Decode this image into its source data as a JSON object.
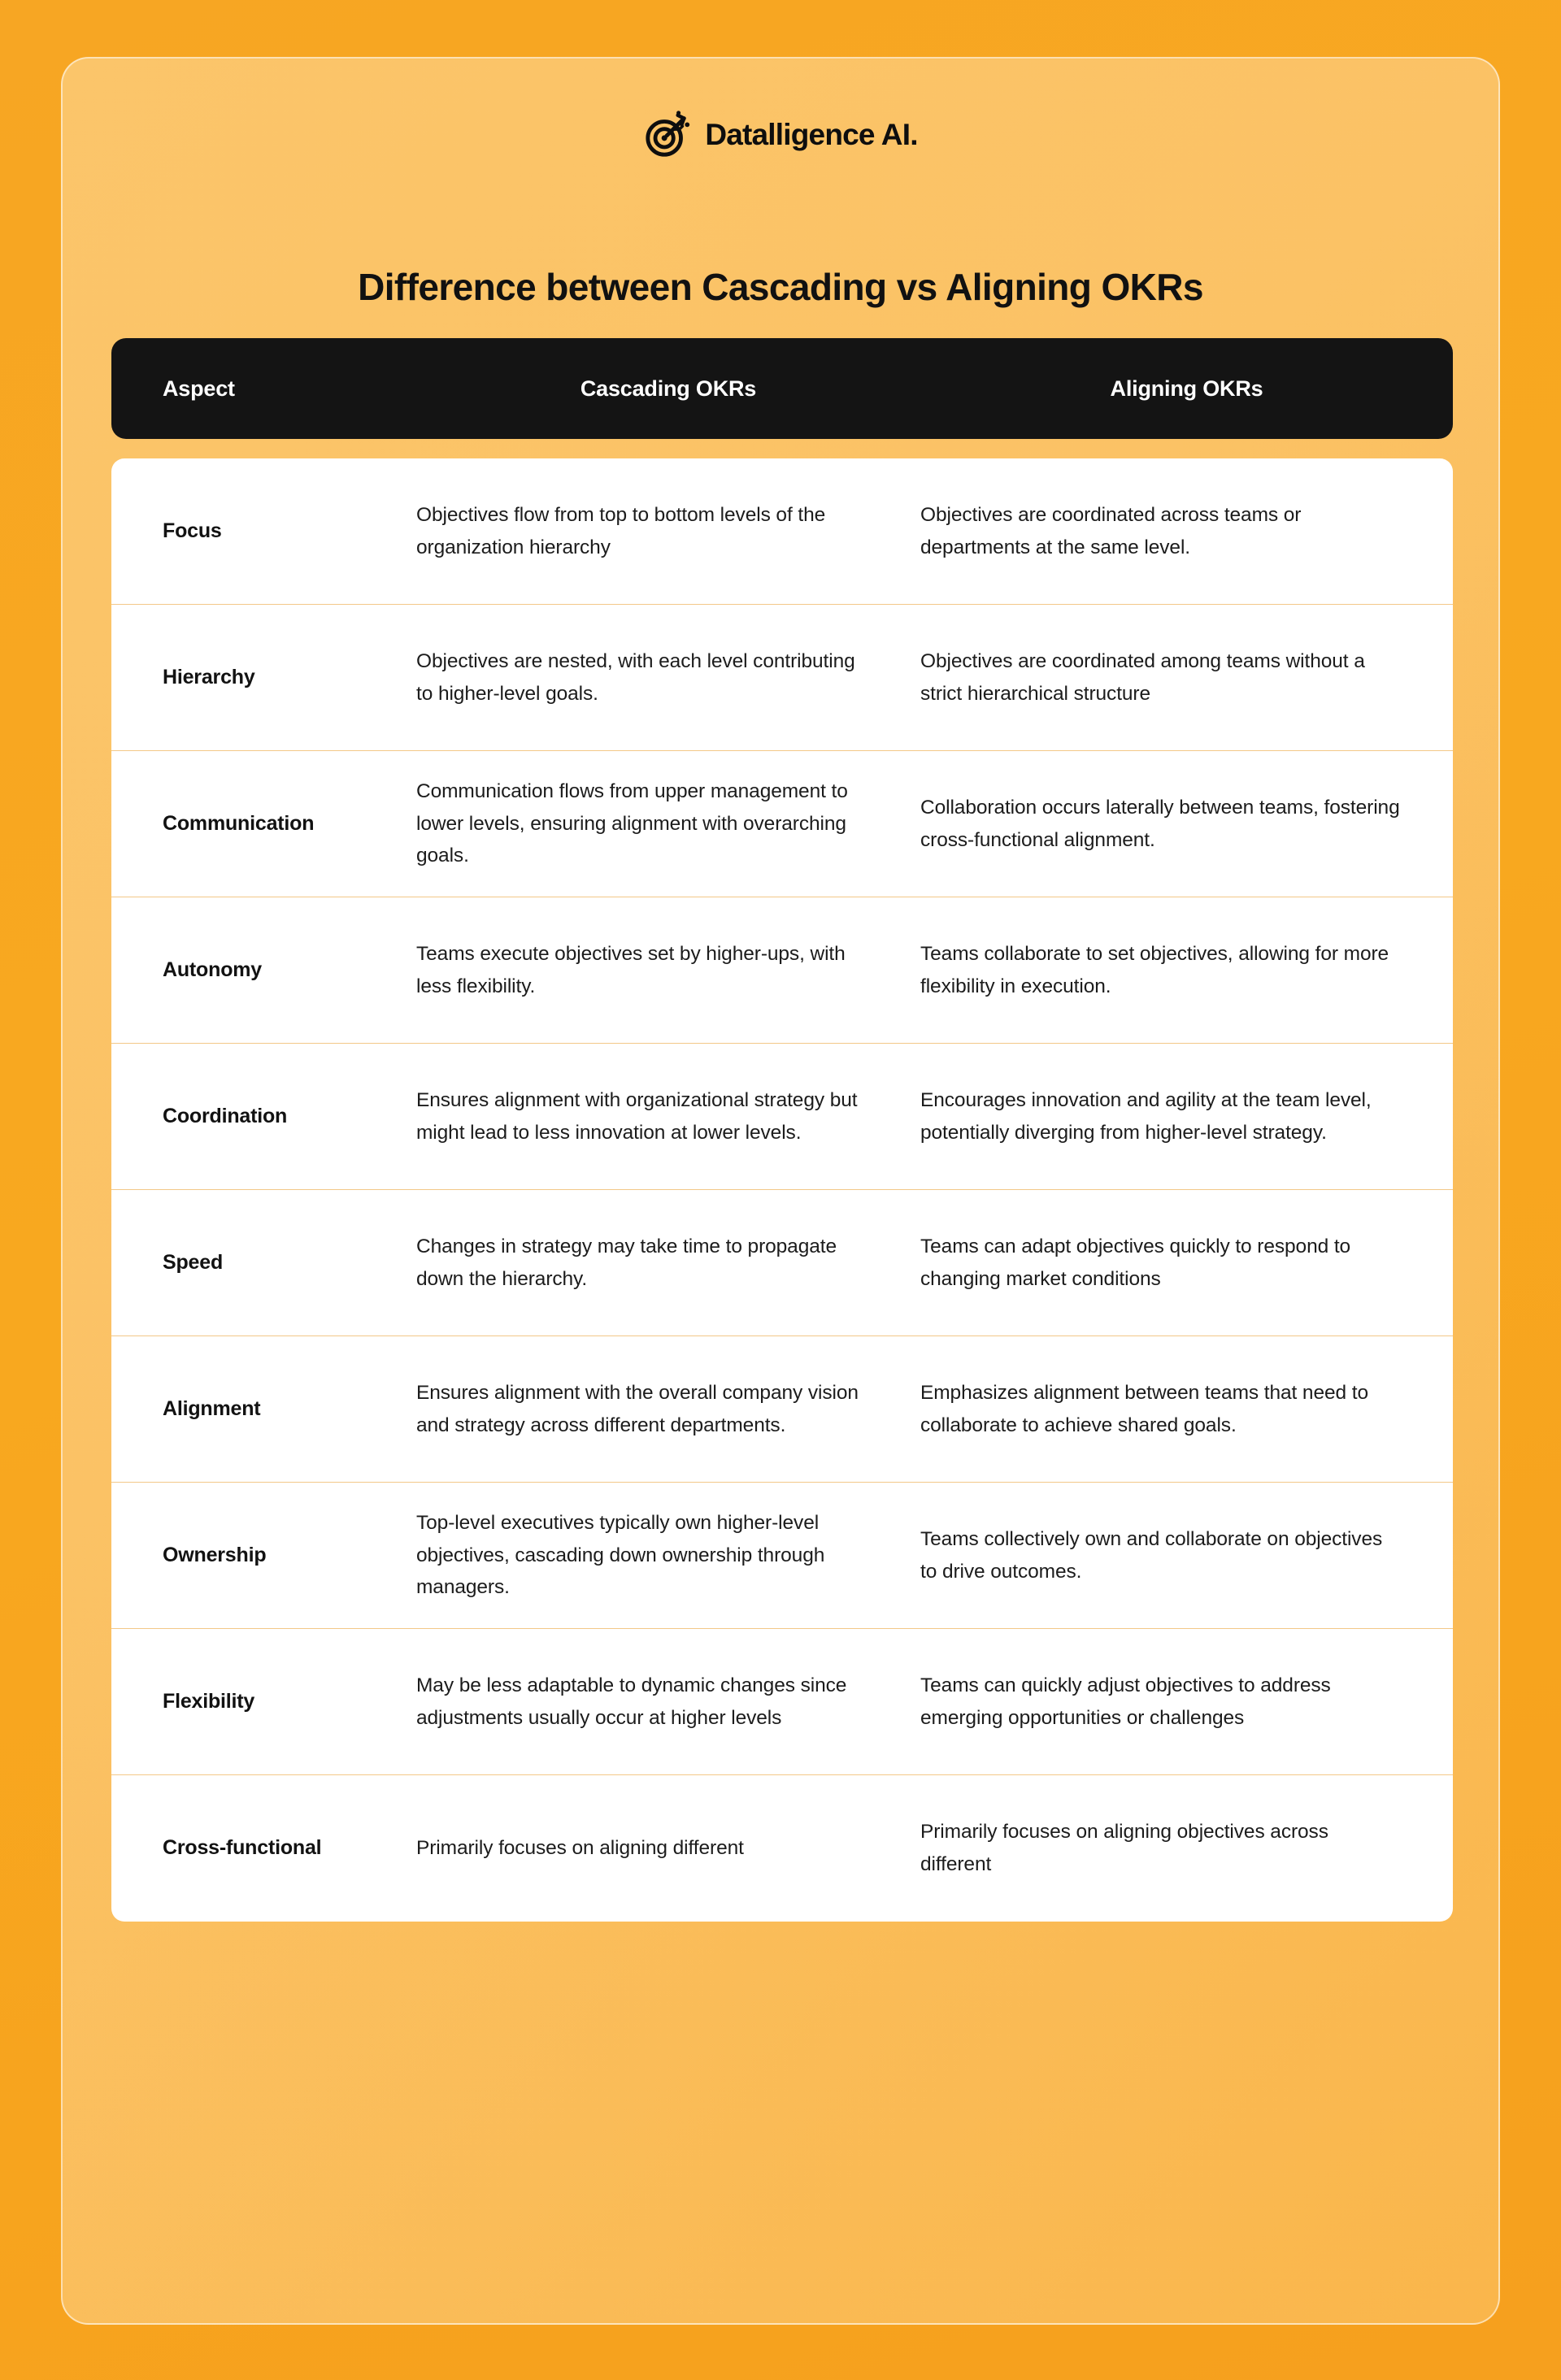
{
  "brand": {
    "name": "Datalligence AI.",
    "logo_icon": "bullseye-target-arrow-icon"
  },
  "title": "Difference between Cascading vs Aligning OKRs",
  "table": {
    "columns": [
      "Aspect",
      "Cascading OKRs",
      "Aligning OKRs"
    ],
    "rows": [
      {
        "aspect": "Focus",
        "cascading": "Objectives flow from top to bottom levels of the organization hierarchy",
        "aligning": "Objectives are coordinated across teams or departments at the same level."
      },
      {
        "aspect": "Hierarchy",
        "cascading": "Objectives are nested, with each level contributing to higher-level goals.",
        "aligning": "Objectives are coordinated among teams without a strict hierarchical structure"
      },
      {
        "aspect": "Communication",
        "cascading": "Communication flows from upper management to lower levels, ensuring alignment with overarching goals.",
        "aligning": "Collaboration occurs laterally between teams, fostering cross-functional alignment."
      },
      {
        "aspect": "Autonomy",
        "cascading": "Teams execute objectives set by higher-ups, with less flexibility.",
        "aligning": "Teams collaborate to set objectives, allowing for more flexibility in execution."
      },
      {
        "aspect": "Coordination",
        "cascading": "Ensures alignment with organizational strategy but might lead to less innovation at lower levels.",
        "aligning": "Encourages innovation and agility at the team level, potentially diverging from higher-level strategy."
      },
      {
        "aspect": "Speed",
        "cascading": "Changes in strategy may take time to propagate down the hierarchy.",
        "aligning": "Teams can adapt objectives quickly to respond to changing market conditions"
      },
      {
        "aspect": "Alignment",
        "cascading": "Ensures alignment with the overall company vision and strategy across different departments.",
        "aligning": "Emphasizes alignment between teams that need to collaborate to achieve shared goals."
      },
      {
        "aspect": "Ownership",
        "cascading": "Top-level executives typically own higher-level objectives, cascading down ownership through managers.",
        "aligning": "Teams collectively own and collaborate on objectives to drive outcomes."
      },
      {
        "aspect": "Flexibility",
        "cascading": "May be less adaptable to dynamic changes since adjustments usually occur at higher levels",
        "aligning": "Teams can quickly adjust objectives to address emerging opportunities or challenges"
      },
      {
        "aspect": "Cross-functional",
        "cascading": "Primarily focuses on aligning different",
        "aligning": "Primarily focuses on aligning objectives across different"
      }
    ]
  },
  "colors": {
    "background_orange": "#F7A623",
    "card_orange": "#FBC465",
    "header_black": "#141414",
    "row_divider": "#F3C888",
    "table_white": "#FFFFFF",
    "text_dark": "#111111"
  }
}
